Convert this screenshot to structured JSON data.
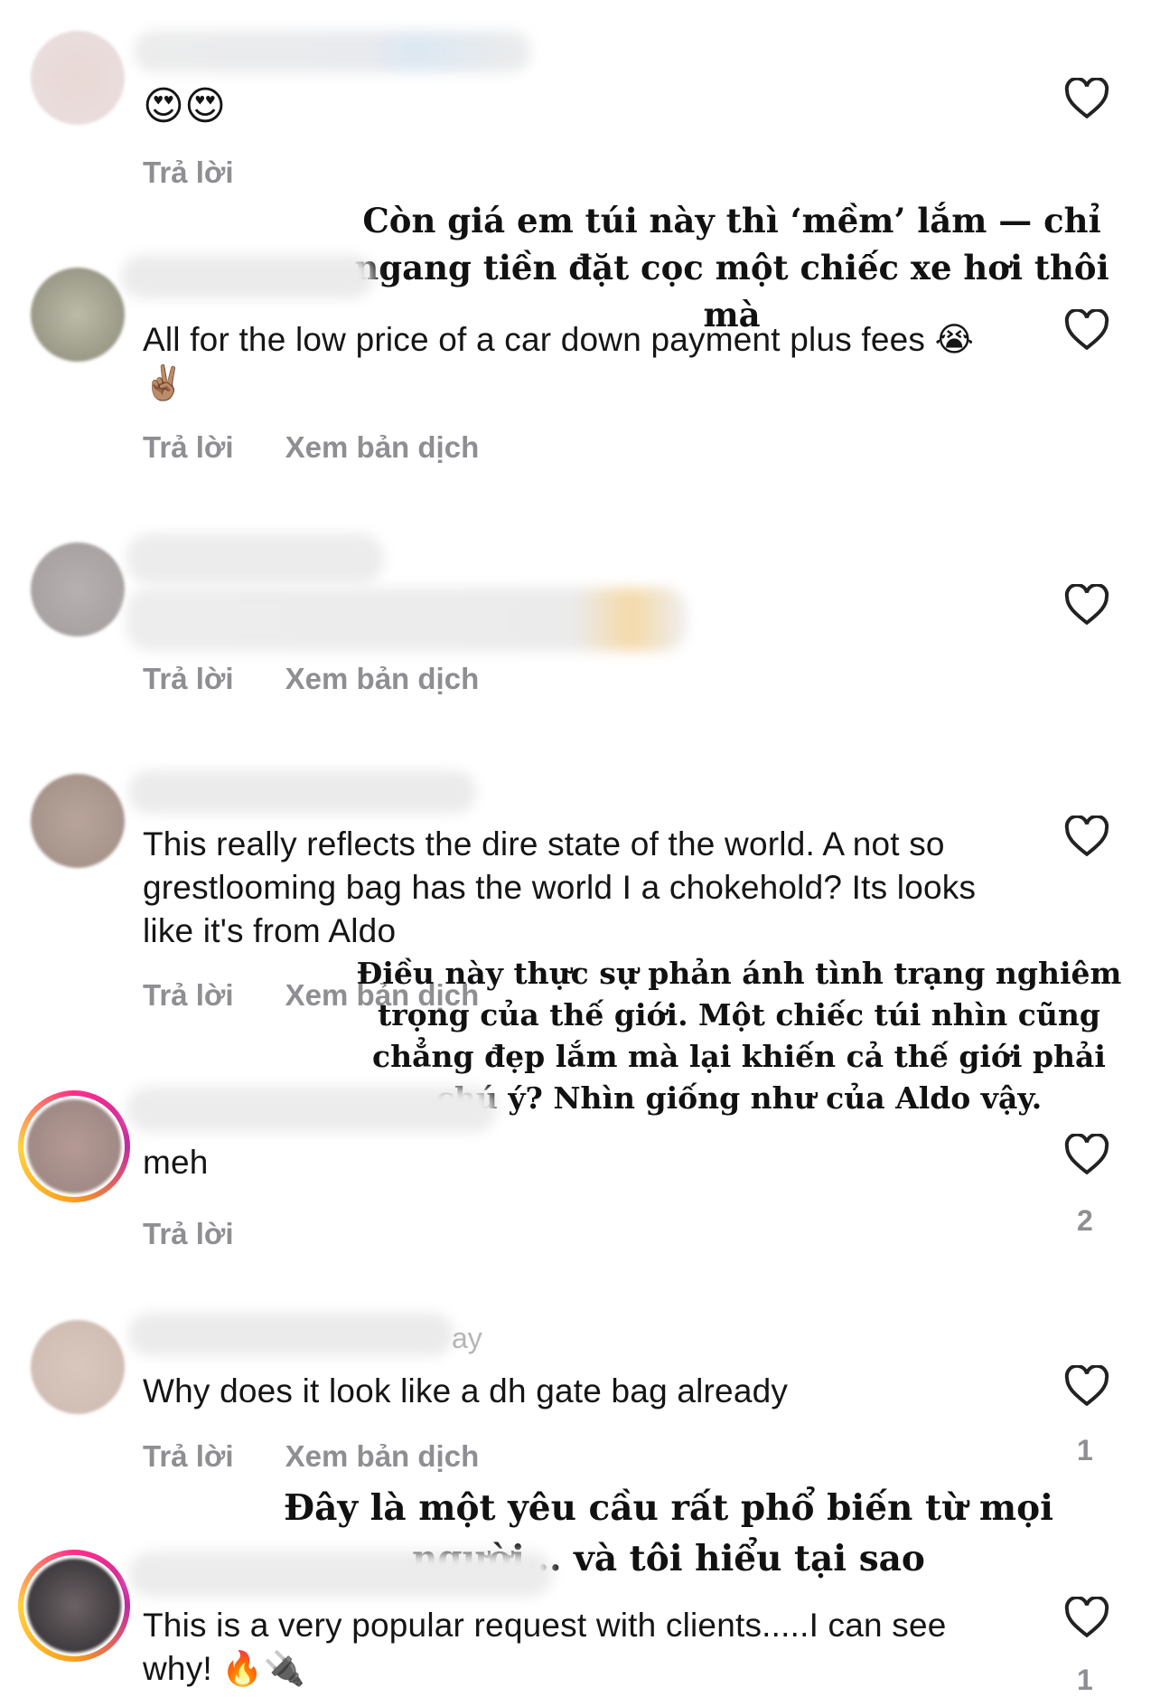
{
  "comments": [
    {
      "text": "😍😍",
      "reply": "Trả lời",
      "translate": "",
      "likes": ""
    },
    {
      "text": "All for the low price of a car down payment plus fees 😭✌🏽",
      "reply": "Trả lời",
      "translate": "Xem bản dịch",
      "likes": ""
    },
    {
      "text": "",
      "reply": "Trả lời",
      "translate": "Xem bản dịch",
      "likes": ""
    },
    {
      "text": "This really reflects the dire state of the world. A not so grestlooming bag has the world I a chokehold? Its looks like it's from Aldo",
      "reply": "Trả lời",
      "translate": "Xem bản dịch",
      "likes": ""
    },
    {
      "text": "meh",
      "reply": "Trả lời",
      "translate": "",
      "likes": "2"
    },
    {
      "text": "Why does it look like a dh gate bag already",
      "reply": "Trả lời",
      "translate": "Xem bản dịch",
      "likes": "1"
    },
    {
      "text": "This is a very popular request with clients.....I can see why! 🔥🔌",
      "reply": "",
      "translate": "",
      "likes": "1"
    }
  ],
  "captions": [
    "Còn giá em túi này thì ‘mềm’ lắm — chỉ ngang tiền đặt cọc một chiếc xe hơi thôi mà",
    "Điều này thực sự phản ánh tình trạng nghiêm trọng của thế giới. Một chiếc túi nhìn cũng chẳng đẹp lắm mà lại khiến cả thế giới phải chú ý? Nhìn giống như của Aldo vậy.",
    "Đây là một yêu cầu rất phổ biến từ mọi người... và tôi hiểu tại sao"
  ],
  "blur_fragment": "ay",
  "icons": {
    "like": "heart-outline-icon"
  }
}
